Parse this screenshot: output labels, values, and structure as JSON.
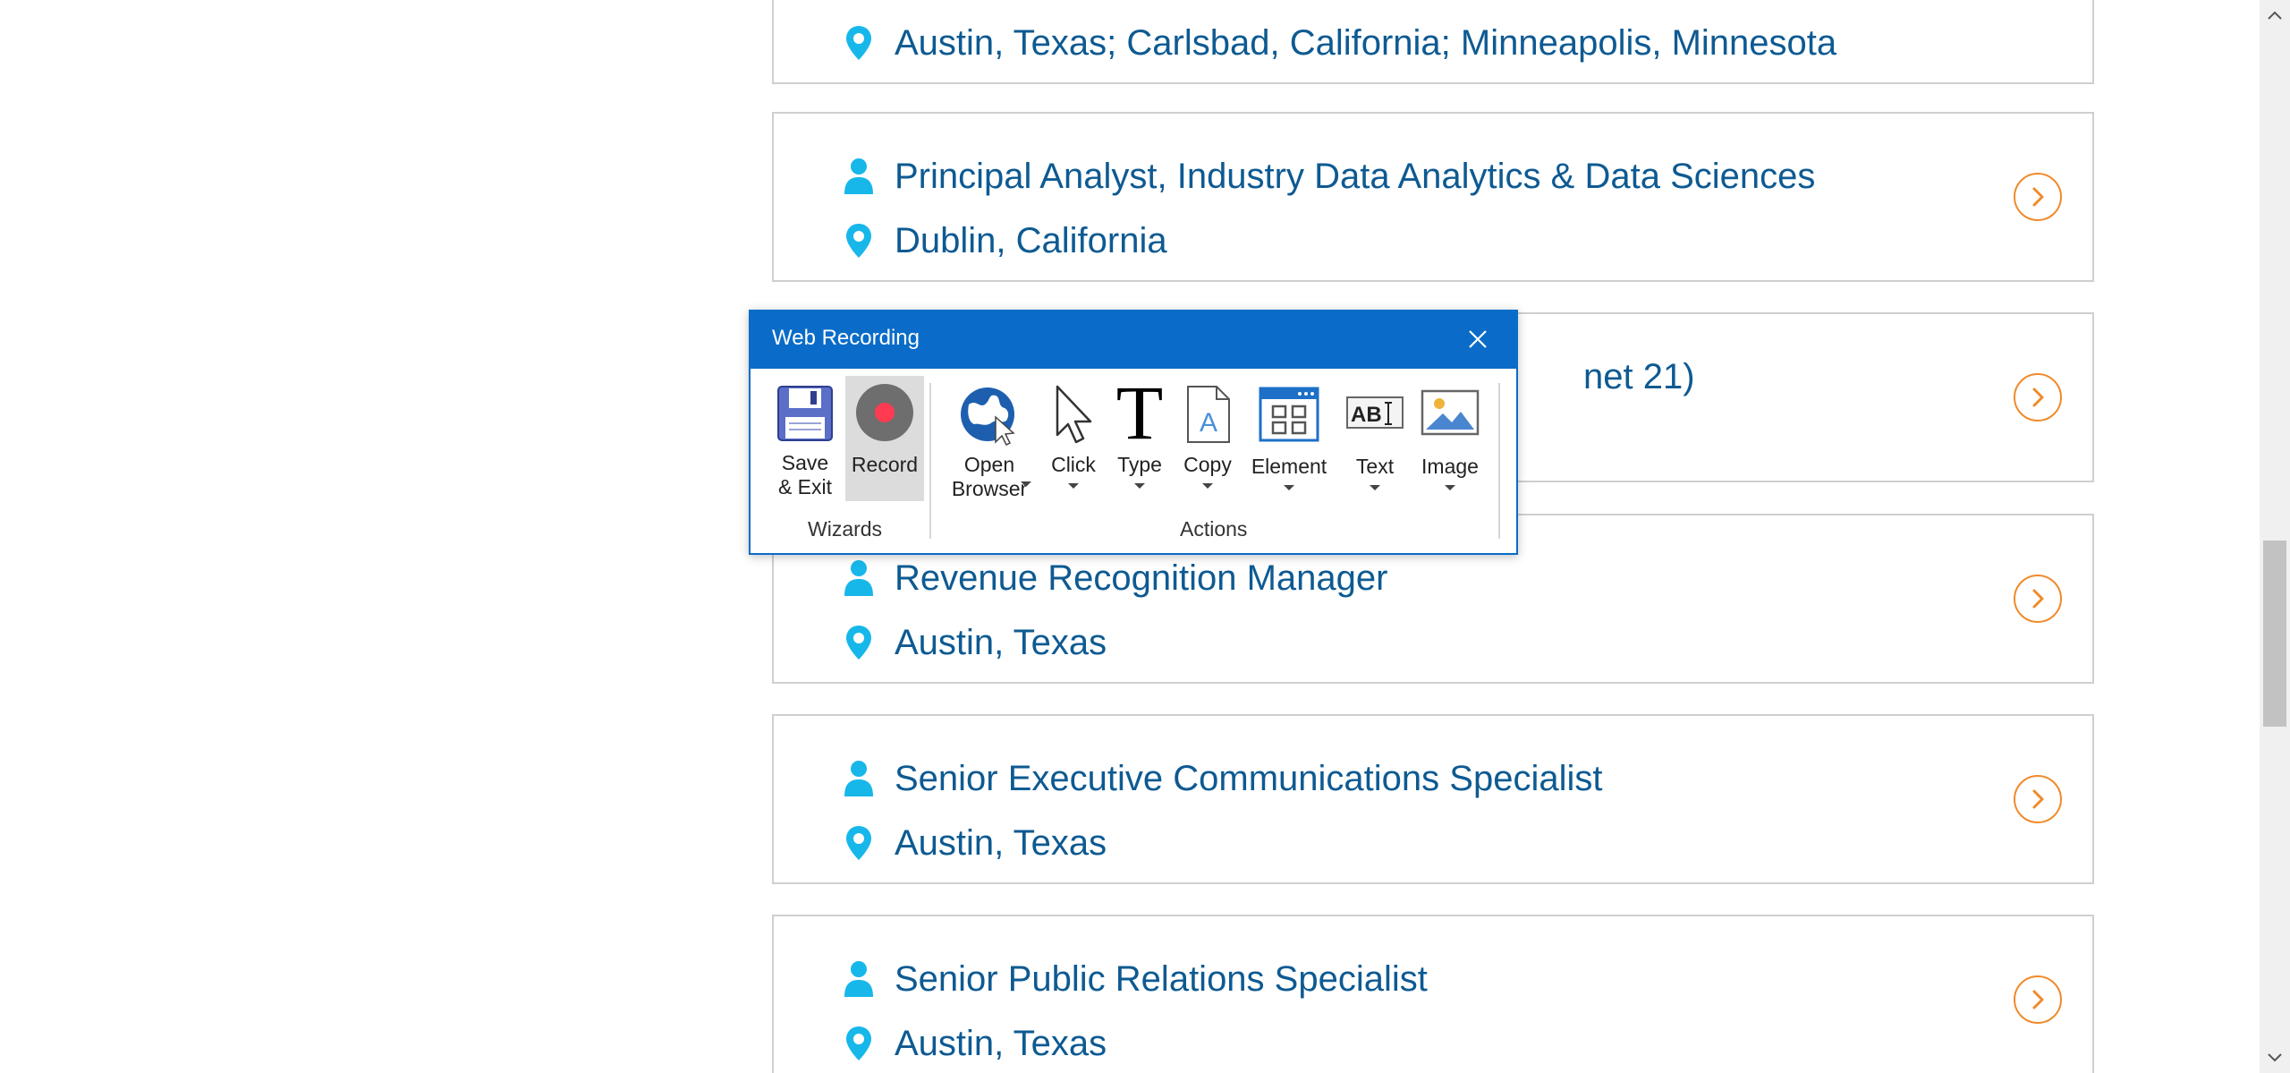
{
  "job_list": [
    {
      "title": "",
      "location": "Austin, Texas; Carlsbad, California; Minneapolis, Minnesota"
    },
    {
      "title": "Principal Analyst, Industry Data Analytics & Data Sciences",
      "location": "Dublin, California"
    },
    {
      "title": "net 21)",
      "location": ""
    },
    {
      "title": "Revenue Recognition Manager",
      "location": "Austin, Texas"
    },
    {
      "title": "Senior Executive Communications Specialist",
      "location": "Austin, Texas"
    },
    {
      "title": "Senior Public Relations Specialist",
      "location": "Austin, Texas"
    }
  ],
  "icons": {
    "person": "person-icon",
    "location": "location-pin-icon",
    "arrow": "chevron-right-icon"
  },
  "colors": {
    "link_text": "#0e5a92",
    "icon_cyan": "#17b7ea",
    "arrow_orange": "#f08a2a",
    "dialog_blue": "#0a6cc8",
    "record_red": "#ff3b52"
  },
  "dialog": {
    "title": "Web Recording",
    "groups": {
      "wizards": "Wizards",
      "actions": "Actions"
    },
    "tools": {
      "save_exit_line1": "Save",
      "save_exit_line2": "& Exit",
      "record": "Record",
      "open_browser_line1": "Open",
      "open_browser_line2": "Browser",
      "click": "Click",
      "type": "Type",
      "copy": "Copy",
      "element": "Element",
      "text": "Text",
      "image": "Image"
    }
  }
}
